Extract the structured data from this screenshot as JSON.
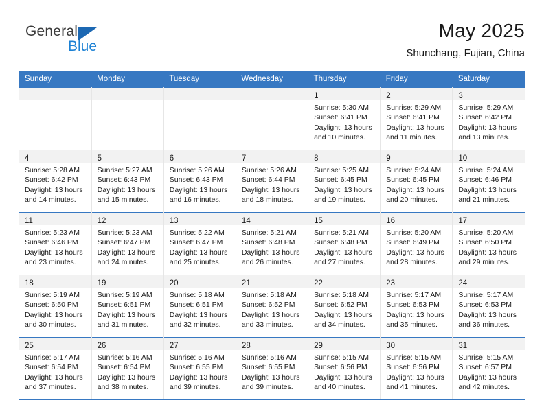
{
  "brand": {
    "name_top": "General",
    "name_bottom": "Blue",
    "triangle_color": "#1c68b3",
    "blue_text_color": "#1c81d4"
  },
  "header": {
    "title": "May 2025",
    "subtitle": "Shunchang, Fujian, China"
  },
  "theme": {
    "header_blue": "#3778c2",
    "daynum_band": "#f2f2f2",
    "cell_border": "#e6e6e6",
    "text": "#1a1a1a"
  },
  "weekdays": [
    "Sunday",
    "Monday",
    "Tuesday",
    "Wednesday",
    "Thursday",
    "Friday",
    "Saturday"
  ],
  "labels": {
    "sunrise_prefix": "Sunrise:",
    "sunset_prefix": "Sunset:",
    "daylight_prefix": "Daylight:"
  },
  "weeks": [
    [
      {
        "day": "",
        "lines": []
      },
      {
        "day": "",
        "lines": []
      },
      {
        "day": "",
        "lines": []
      },
      {
        "day": "",
        "lines": []
      },
      {
        "day": "1",
        "lines": [
          "Sunrise: 5:30 AM",
          "Sunset: 6:41 PM",
          "Daylight: 13 hours",
          "and 10 minutes."
        ]
      },
      {
        "day": "2",
        "lines": [
          "Sunrise: 5:29 AM",
          "Sunset: 6:41 PM",
          "Daylight: 13 hours",
          "and 11 minutes."
        ]
      },
      {
        "day": "3",
        "lines": [
          "Sunrise: 5:29 AM",
          "Sunset: 6:42 PM",
          "Daylight: 13 hours",
          "and 13 minutes."
        ]
      }
    ],
    [
      {
        "day": "4",
        "lines": [
          "Sunrise: 5:28 AM",
          "Sunset: 6:42 PM",
          "Daylight: 13 hours",
          "and 14 minutes."
        ]
      },
      {
        "day": "5",
        "lines": [
          "Sunrise: 5:27 AM",
          "Sunset: 6:43 PM",
          "Daylight: 13 hours",
          "and 15 minutes."
        ]
      },
      {
        "day": "6",
        "lines": [
          "Sunrise: 5:26 AM",
          "Sunset: 6:43 PM",
          "Daylight: 13 hours",
          "and 16 minutes."
        ]
      },
      {
        "day": "7",
        "lines": [
          "Sunrise: 5:26 AM",
          "Sunset: 6:44 PM",
          "Daylight: 13 hours",
          "and 18 minutes."
        ]
      },
      {
        "day": "8",
        "lines": [
          "Sunrise: 5:25 AM",
          "Sunset: 6:45 PM",
          "Daylight: 13 hours",
          "and 19 minutes."
        ]
      },
      {
        "day": "9",
        "lines": [
          "Sunrise: 5:24 AM",
          "Sunset: 6:45 PM",
          "Daylight: 13 hours",
          "and 20 minutes."
        ]
      },
      {
        "day": "10",
        "lines": [
          "Sunrise: 5:24 AM",
          "Sunset: 6:46 PM",
          "Daylight: 13 hours",
          "and 21 minutes."
        ]
      }
    ],
    [
      {
        "day": "11",
        "lines": [
          "Sunrise: 5:23 AM",
          "Sunset: 6:46 PM",
          "Daylight: 13 hours",
          "and 23 minutes."
        ]
      },
      {
        "day": "12",
        "lines": [
          "Sunrise: 5:23 AM",
          "Sunset: 6:47 PM",
          "Daylight: 13 hours",
          "and 24 minutes."
        ]
      },
      {
        "day": "13",
        "lines": [
          "Sunrise: 5:22 AM",
          "Sunset: 6:47 PM",
          "Daylight: 13 hours",
          "and 25 minutes."
        ]
      },
      {
        "day": "14",
        "lines": [
          "Sunrise: 5:21 AM",
          "Sunset: 6:48 PM",
          "Daylight: 13 hours",
          "and 26 minutes."
        ]
      },
      {
        "day": "15",
        "lines": [
          "Sunrise: 5:21 AM",
          "Sunset: 6:48 PM",
          "Daylight: 13 hours",
          "and 27 minutes."
        ]
      },
      {
        "day": "16",
        "lines": [
          "Sunrise: 5:20 AM",
          "Sunset: 6:49 PM",
          "Daylight: 13 hours",
          "and 28 minutes."
        ]
      },
      {
        "day": "17",
        "lines": [
          "Sunrise: 5:20 AM",
          "Sunset: 6:50 PM",
          "Daylight: 13 hours",
          "and 29 minutes."
        ]
      }
    ],
    [
      {
        "day": "18",
        "lines": [
          "Sunrise: 5:19 AM",
          "Sunset: 6:50 PM",
          "Daylight: 13 hours",
          "and 30 minutes."
        ]
      },
      {
        "day": "19",
        "lines": [
          "Sunrise: 5:19 AM",
          "Sunset: 6:51 PM",
          "Daylight: 13 hours",
          "and 31 minutes."
        ]
      },
      {
        "day": "20",
        "lines": [
          "Sunrise: 5:18 AM",
          "Sunset: 6:51 PM",
          "Daylight: 13 hours",
          "and 32 minutes."
        ]
      },
      {
        "day": "21",
        "lines": [
          "Sunrise: 5:18 AM",
          "Sunset: 6:52 PM",
          "Daylight: 13 hours",
          "and 33 minutes."
        ]
      },
      {
        "day": "22",
        "lines": [
          "Sunrise: 5:18 AM",
          "Sunset: 6:52 PM",
          "Daylight: 13 hours",
          "and 34 minutes."
        ]
      },
      {
        "day": "23",
        "lines": [
          "Sunrise: 5:17 AM",
          "Sunset: 6:53 PM",
          "Daylight: 13 hours",
          "and 35 minutes."
        ]
      },
      {
        "day": "24",
        "lines": [
          "Sunrise: 5:17 AM",
          "Sunset: 6:53 PM",
          "Daylight: 13 hours",
          "and 36 minutes."
        ]
      }
    ],
    [
      {
        "day": "25",
        "lines": [
          "Sunrise: 5:17 AM",
          "Sunset: 6:54 PM",
          "Daylight: 13 hours",
          "and 37 minutes."
        ]
      },
      {
        "day": "26",
        "lines": [
          "Sunrise: 5:16 AM",
          "Sunset: 6:54 PM",
          "Daylight: 13 hours",
          "and 38 minutes."
        ]
      },
      {
        "day": "27",
        "lines": [
          "Sunrise: 5:16 AM",
          "Sunset: 6:55 PM",
          "Daylight: 13 hours",
          "and 39 minutes."
        ]
      },
      {
        "day": "28",
        "lines": [
          "Sunrise: 5:16 AM",
          "Sunset: 6:55 PM",
          "Daylight: 13 hours",
          "and 39 minutes."
        ]
      },
      {
        "day": "29",
        "lines": [
          "Sunrise: 5:15 AM",
          "Sunset: 6:56 PM",
          "Daylight: 13 hours",
          "and 40 minutes."
        ]
      },
      {
        "day": "30",
        "lines": [
          "Sunrise: 5:15 AM",
          "Sunset: 6:56 PM",
          "Daylight: 13 hours",
          "and 41 minutes."
        ]
      },
      {
        "day": "31",
        "lines": [
          "Sunrise: 5:15 AM",
          "Sunset: 6:57 PM",
          "Daylight: 13 hours",
          "and 42 minutes."
        ]
      }
    ]
  ]
}
